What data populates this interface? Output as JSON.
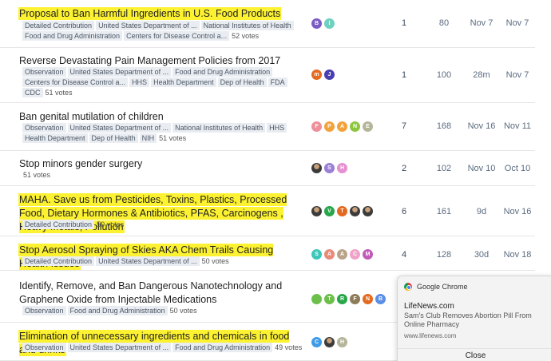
{
  "topics": [
    {
      "title": "Proposal to Ban Harmful Ingredients in U.S. Food Products",
      "highlighted": true,
      "tags": [
        "Detailed Contribution",
        "United States Department of ...",
        "National Institutes of Health",
        "Food and Drug Administration",
        "Centers for Disease Control a..."
      ],
      "votes": "52 votes",
      "avatars": [
        {
          "letter": "B",
          "color": "#7b5cc4"
        },
        {
          "letter": "I",
          "color": "#6fd1c0"
        }
      ],
      "replies": "1",
      "views": "80",
      "activity1": "Nov 7",
      "activity2": "Nov 7"
    },
    {
      "title": "Reverse Devastating Pain Management Policies from 2017",
      "highlighted": false,
      "tags": [
        "Observation",
        "United States Department of ...",
        "Food and Drug Administration",
        "Centers for Disease Control a...",
        "HHS",
        "Health Department",
        "Dep of Health",
        "FDA",
        "CDC"
      ],
      "votes": "51 votes",
      "avatars": [
        {
          "letter": "m",
          "color": "#e46a1f"
        },
        {
          "letter": "J",
          "color": "#4a3fb0"
        }
      ],
      "replies": "1",
      "views": "100",
      "activity1": "28m",
      "activity2": "Nov 7"
    },
    {
      "title": "Ban genital mutilation of children",
      "highlighted": false,
      "tags": [
        "Observation",
        "United States Department of ...",
        "National Institutes of Health",
        "HHS",
        "Health Department",
        "Dep of Health",
        "NIH"
      ],
      "votes": "51 votes",
      "avatars": [
        {
          "letter": "F",
          "color": "#ee8f9a"
        },
        {
          "letter": "P",
          "color": "#f2a23a"
        },
        {
          "letter": "A",
          "color": "#f2a23a"
        },
        {
          "letter": "N",
          "color": "#8dc63f"
        },
        {
          "letter": "E",
          "color": "#b5b59a"
        }
      ],
      "replies": "7",
      "views": "168",
      "activity1": "Nov 16",
      "activity2": "Nov 11"
    },
    {
      "title": "Stop minors gender surgery",
      "highlighted": false,
      "tags": [],
      "votes": "51 votes",
      "avatars": [
        {
          "letter": "",
          "color": "#333333",
          "photo": true
        },
        {
          "letter": "S",
          "color": "#9b7fd6"
        },
        {
          "letter": "H",
          "color": "#e58fd0"
        }
      ],
      "replies": "2",
      "views": "102",
      "activity1": "Nov 10",
      "activity2": "Oct 10"
    },
    {
      "title": "MAHA. Save us from Pesticides, Toxins, Plastics, Processed Food, Dietary Hormones & Antibiotics, PFAS, Carcinogens , Heavy Metals, Pollution",
      "highlighted": true,
      "tags": [
        "Detailed Contribution"
      ],
      "votes": "50 votes",
      "avatars": [
        {
          "letter": "",
          "color": "#333333",
          "photo": true
        },
        {
          "letter": "V",
          "color": "#27a64a"
        },
        {
          "letter": "T",
          "color": "#e46a1f"
        },
        {
          "letter": "",
          "color": "#333333",
          "photo": true
        },
        {
          "letter": "",
          "color": "#333333",
          "photo": true
        }
      ],
      "replies": "6",
      "views": "161",
      "activity1": "9d",
      "activity2": "Nov 16"
    },
    {
      "title": "Stop Aerosol Spraying of Skies AKA Chem Trails Causing Health Issues",
      "highlighted": true,
      "tags": [
        "Detailed Contribution",
        "United States Department of ..."
      ],
      "votes": "50 votes",
      "avatars": [
        {
          "letter": "S",
          "color": "#3ec6b8"
        },
        {
          "letter": "A",
          "color": "#e98a79"
        },
        {
          "letter": "A",
          "color": "#b9a48a"
        },
        {
          "letter": "C",
          "color": "#f0a3c8"
        },
        {
          "letter": "M",
          "color": "#c05bb8"
        }
      ],
      "replies": "4",
      "views": "128",
      "activity1": "30d",
      "activity2": "Nov 18"
    },
    {
      "title": "Identify, Remove, and Ban Dangerous Nanotechnology and Graphene Oxide from Injectable Medications",
      "highlighted": false,
      "tags": [
        "Observation",
        "Food and Drug Administration"
      ],
      "votes": "50 votes",
      "avatars": [
        {
          "letter": "",
          "color": "#6cc04a"
        },
        {
          "letter": "T",
          "color": "#6cc04a"
        },
        {
          "letter": "R",
          "color": "#27a64a"
        },
        {
          "letter": "F",
          "color": "#8d7b5a"
        },
        {
          "letter": "N",
          "color": "#e46a1f"
        },
        {
          "letter": "B",
          "color": "#5b8ee6"
        }
      ],
      "replies": "",
      "views": "",
      "activity1": "",
      "activity2": ""
    },
    {
      "title": "Elimination of unnecessary ingredients and chemicals in food and drinks",
      "highlighted": true,
      "tags": [
        "Observation",
        "United States Department of ...",
        "Food and Drug Administration"
      ],
      "votes": "49 votes",
      "avatars": [
        {
          "letter": "C",
          "color": "#3d9be9"
        },
        {
          "letter": "",
          "color": "#333333",
          "photo": true
        },
        {
          "letter": "H",
          "color": "#b5b59a"
        }
      ],
      "replies": "",
      "views": "",
      "activity1": "",
      "activity2": ""
    }
  ],
  "notification": {
    "app": "Google Chrome",
    "site": "LifeNews.com",
    "message": "Sam's Club Removes Abortion Pill From Online Pharmacy",
    "url": "www.lifenews.com",
    "close_label": "Close"
  }
}
